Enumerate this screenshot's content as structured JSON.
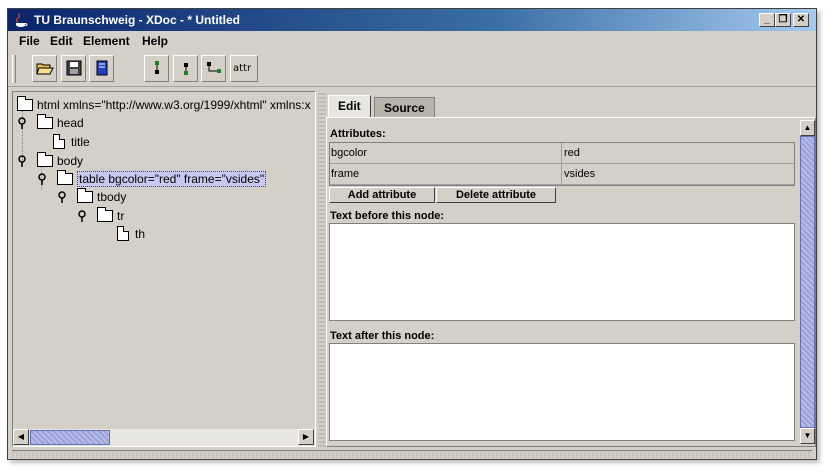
{
  "window": {
    "title": "TU Braunschweig - XDoc - * Untitled"
  },
  "menu": [
    "File",
    "Edit",
    "Element",
    "Help"
  ],
  "toolbar": {
    "open_icon": "folder-open-icon",
    "save_icon": "save-icon",
    "help_icon": "book-icon",
    "attr_label": "attr"
  },
  "tree": {
    "root": "html xmlns=\"http://www.w3.org/1999/xhtml\" xmlns:x",
    "head": "head",
    "title": "title",
    "body": "body",
    "table": "table bgcolor=\"red\" frame=\"vsides\"",
    "tbody": "tbody",
    "tr": "tr",
    "th": "th"
  },
  "tabs": {
    "edit": "Edit",
    "source": "Source"
  },
  "editor": {
    "attributes_label": "Attributes:",
    "attributes": [
      {
        "name": "bgcolor",
        "value": "red"
      },
      {
        "name": "frame",
        "value": "vsides"
      }
    ],
    "add_attribute": "Add attribute",
    "delete_attribute": "Delete attribute",
    "text_before_label": "Text before this node:",
    "text_after_label": "Text after this node:",
    "text_before_value": "",
    "text_after_value": ""
  }
}
